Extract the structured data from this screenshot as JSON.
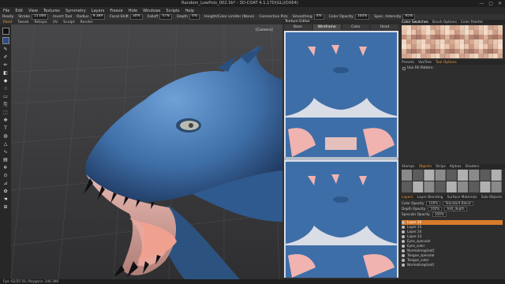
{
  "window": {
    "title": "Random_LowPolo_002.3b* - 3D-COAT 4.1.17D(GL)(DX64)",
    "controls": [
      "—",
      "▢",
      "✕"
    ]
  },
  "menu": [
    "File",
    "Edit",
    "View",
    "Textures",
    "Symmetry",
    "Layers",
    "Freeze",
    "Hide",
    "Windows",
    "Scripts",
    "Help"
  ],
  "tool_options": {
    "mode_label": "Ready",
    "stroke_label": "Stroke",
    "stroke_value": "15.000",
    "invert_tool": "Invert Tool",
    "radius_label": "Radius",
    "radius_value": "9.389",
    "focal_shift_label": "Focal Shift",
    "focal_shift_value": "30%",
    "falloff_label": "Falloff",
    "falloff_value": "47%",
    "depth_label": "Depth",
    "depth_value": "6%",
    "height_color_label": "Height/Color Limiter (None)",
    "connective_pick": "Connective Pick",
    "smoothing_label": "Smoothing",
    "smoothing_value": "0%",
    "color_opacity_label": "Color Opacity",
    "color_opacity_value": "100%",
    "spec_intensity_label": "Spec. Intensity",
    "spec_intensity_value": "95%"
  },
  "room_tabs": [
    {
      "label": "Paint",
      "active": true
    },
    {
      "label": "Tweak",
      "active": false
    },
    {
      "label": "Retopo",
      "active": false
    },
    {
      "label": "UV",
      "active": false
    },
    {
      "label": "Sculpt",
      "active": false
    },
    {
      "label": "Render",
      "active": false
    }
  ],
  "viewport": {
    "camera_label": "[Camera]"
  },
  "texture_editor": {
    "title": "Texture Editor",
    "tabs": [
      {
        "label": "Base",
        "active": false
      },
      {
        "label": "Wireframe",
        "active": true
      },
      {
        "label": "Color",
        "active": false
      },
      {
        "label": "Head",
        "active": false
      }
    ],
    "colors": {
      "skin": "#3e6ea8",
      "pink": "#f0b3b0",
      "bg": "#d9dde6"
    }
  },
  "right_panel": {
    "top_tabs": [
      "Color Swatches",
      "Brush Options",
      "Color Palette"
    ],
    "mid_tabs": [
      {
        "label": "Presets",
        "active": false
      },
      {
        "label": "VoxTree",
        "active": false
      },
      {
        "label": "Tool Options",
        "active": true
      }
    ],
    "use_fill_pattern": "Use Fill Pattern",
    "material_tabs": [
      "Stamps",
      "Objects",
      "Strips",
      "Alphas",
      "Shaders"
    ],
    "layer_tabs": [
      "Layers",
      "Layer Blending",
      "Surface Materials",
      "Sub-Objects"
    ],
    "props": [
      {
        "label": "Color Opacity",
        "value": "100%",
        "extra": "Standard Blend"
      },
      {
        "label": "Depth Opacity",
        "value": "100%",
        "extra": "Add_depth"
      },
      {
        "label": "Specular Opacity",
        "value": "100%",
        "extra": ""
      }
    ],
    "layers": [
      {
        "name": "Layer 26",
        "selected": true
      },
      {
        "name": "Layer 25",
        "selected": false
      },
      {
        "name": "Layer 24",
        "selected": false
      },
      {
        "name": "Layer 23",
        "selected": false
      },
      {
        "name": "Eyes_specular",
        "selected": false
      },
      {
        "name": "Eyes_color",
        "selected": false
      },
      {
        "name": "Normalmap[ext]",
        "selected": false
      },
      {
        "name": "Tongue_specular",
        "selected": false
      },
      {
        "name": "Tongue_color",
        "selected": false
      },
      {
        "name": "Normalmap[ext]",
        "selected": false
      }
    ]
  },
  "status": {
    "text": "Fps: 62/25 50, Polygons: 248 396"
  }
}
